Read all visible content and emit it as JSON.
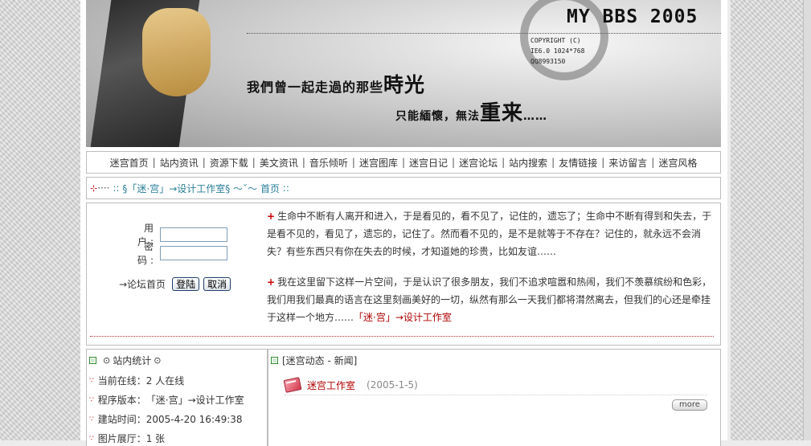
{
  "banner": {
    "title": "MY BBS 2005",
    "copyright": "COPYRIGHT (C)",
    "browser": "IE6.0 1024*768",
    "qq": "QQ8993150",
    "slogan1_prefix": "我們曾一起走過的那些",
    "slogan1_emph": "時光",
    "slogan2_prefix": "只能緬懷，無法",
    "slogan2_emph": "重来",
    "slogan2_suffix": "……"
  },
  "nav": {
    "items": [
      "迷宫首页",
      "站内资讯",
      "资源下载",
      "美文资讯",
      "音乐倾听",
      "迷宫图库",
      "迷宫日记",
      "迷宫论坛",
      "站内搜索",
      "友情链接",
      "来访留言",
      "迷宫风格"
    ]
  },
  "breadcrumb": {
    "prefix": "::",
    "site": "§「迷·宫」→设计工作室§",
    "tilde": "～ˇ～",
    "home": "首页",
    "suffix": "::"
  },
  "login": {
    "user_label": "用 户:",
    "pass_label": "密 码:",
    "user_value": "",
    "pass_value": "",
    "forum_link": "→论坛首页",
    "login_button": "登陆",
    "cancel_button": "取消"
  },
  "intro": {
    "plus": "+",
    "para1": "生命中不断有人离开和进入，于是看见的，看不见了，记住的，遗忘了；生命中不断有得到和失去，于是看不见的，看见了，遗忘的，记住了。然而看不见的，是不是就等于不存在？记住的，就永远不会消失？有些东西只有你在失去的时候，才知道她的珍贵，比如友谊……",
    "para2": "我在这里留下这样一片空间，于是认识了很多朋友，我们不追求喧嚣和热闹，我们不羡慕缤纷和色彩，我们用我们最真的语言在这里刻画美好的一切，纵然有那么一天我们都将潸然离去，但我们的心还是牵挂于这样一个地方……",
    "para2_sign": "「迷·宫」→设计工作室"
  },
  "stats": {
    "title": "站内统计",
    "circle": "⊙",
    "bullet": "∵",
    "online_label": "当前在线：",
    "online_value": "2 人在线",
    "version_label": "程序版本：",
    "version_value": "「迷·宫」→设计工作室",
    "founded_label": "建站时间：",
    "founded_value": "2005-4-20 16:49:38",
    "gallery_partial": "图片展厅：1 张"
  },
  "news": {
    "title": "[迷宫动态 - 新闻]",
    "items": [
      {
        "title": "迷宫工作室",
        "date": "(2005-1-5)"
      }
    ],
    "more": "more"
  }
}
